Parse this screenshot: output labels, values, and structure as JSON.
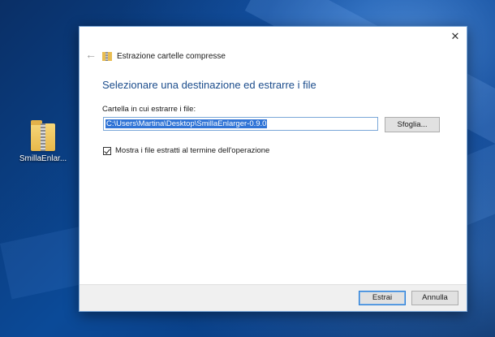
{
  "desktop": {
    "icon_label": "SmillaEnlar...",
    "icon": "zip-folder-icon"
  },
  "dialog": {
    "title": "Estrazione cartelle compresse",
    "heading": "Selezionare una destinazione ed estrarre i file",
    "field_label": "Cartella in cui estrarre i file:",
    "path_value": "C:\\Users\\Martina\\Desktop\\SmillaEnlarger-0.9.0",
    "browse_label": "Sfoglia...",
    "checkbox_label": "Mostra i file estratti al termine dell'operazione",
    "checkbox_checked": true,
    "extract_label": "Estrai",
    "cancel_label": "Annulla",
    "close_glyph": "✕",
    "back_glyph": "←"
  },
  "colors": {
    "heading": "#1c4d8c",
    "selection": "#3074d6",
    "desktop": "#0b4a98"
  }
}
